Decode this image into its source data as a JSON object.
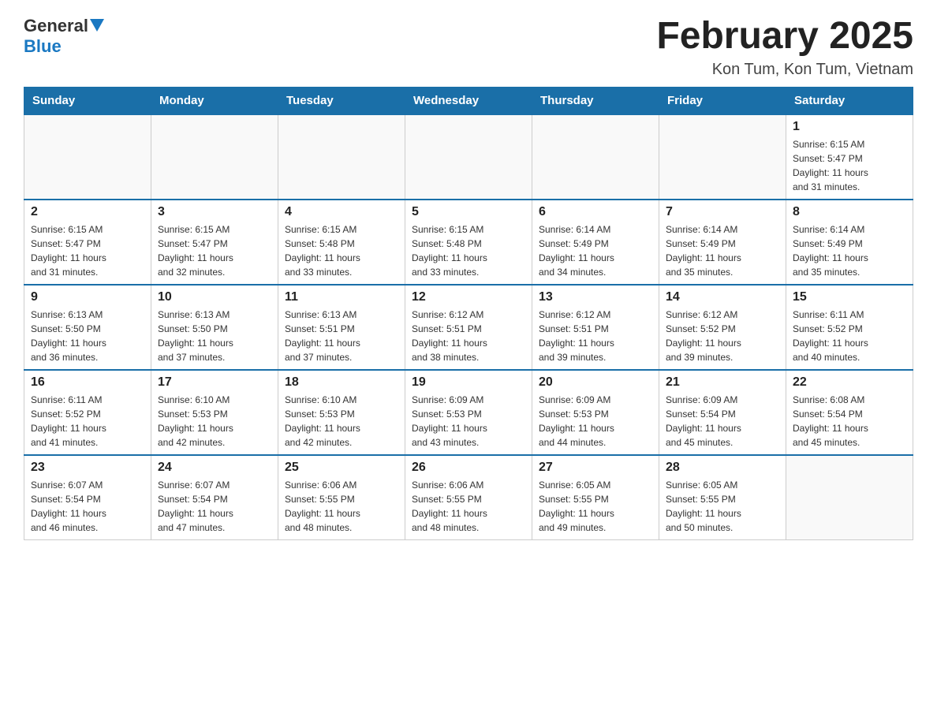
{
  "header": {
    "logo_general": "General",
    "logo_blue": "Blue",
    "month_title": "February 2025",
    "location": "Kon Tum, Kon Tum, Vietnam"
  },
  "weekdays": [
    "Sunday",
    "Monday",
    "Tuesday",
    "Wednesday",
    "Thursday",
    "Friday",
    "Saturday"
  ],
  "weeks": [
    {
      "days": [
        {
          "number": "",
          "info": ""
        },
        {
          "number": "",
          "info": ""
        },
        {
          "number": "",
          "info": ""
        },
        {
          "number": "",
          "info": ""
        },
        {
          "number": "",
          "info": ""
        },
        {
          "number": "",
          "info": ""
        },
        {
          "number": "1",
          "info": "Sunrise: 6:15 AM\nSunset: 5:47 PM\nDaylight: 11 hours\nand 31 minutes."
        }
      ]
    },
    {
      "days": [
        {
          "number": "2",
          "info": "Sunrise: 6:15 AM\nSunset: 5:47 PM\nDaylight: 11 hours\nand 31 minutes."
        },
        {
          "number": "3",
          "info": "Sunrise: 6:15 AM\nSunset: 5:47 PM\nDaylight: 11 hours\nand 32 minutes."
        },
        {
          "number": "4",
          "info": "Sunrise: 6:15 AM\nSunset: 5:48 PM\nDaylight: 11 hours\nand 33 minutes."
        },
        {
          "number": "5",
          "info": "Sunrise: 6:15 AM\nSunset: 5:48 PM\nDaylight: 11 hours\nand 33 minutes."
        },
        {
          "number": "6",
          "info": "Sunrise: 6:14 AM\nSunset: 5:49 PM\nDaylight: 11 hours\nand 34 minutes."
        },
        {
          "number": "7",
          "info": "Sunrise: 6:14 AM\nSunset: 5:49 PM\nDaylight: 11 hours\nand 35 minutes."
        },
        {
          "number": "8",
          "info": "Sunrise: 6:14 AM\nSunset: 5:49 PM\nDaylight: 11 hours\nand 35 minutes."
        }
      ]
    },
    {
      "days": [
        {
          "number": "9",
          "info": "Sunrise: 6:13 AM\nSunset: 5:50 PM\nDaylight: 11 hours\nand 36 minutes."
        },
        {
          "number": "10",
          "info": "Sunrise: 6:13 AM\nSunset: 5:50 PM\nDaylight: 11 hours\nand 37 minutes."
        },
        {
          "number": "11",
          "info": "Sunrise: 6:13 AM\nSunset: 5:51 PM\nDaylight: 11 hours\nand 37 minutes."
        },
        {
          "number": "12",
          "info": "Sunrise: 6:12 AM\nSunset: 5:51 PM\nDaylight: 11 hours\nand 38 minutes."
        },
        {
          "number": "13",
          "info": "Sunrise: 6:12 AM\nSunset: 5:51 PM\nDaylight: 11 hours\nand 39 minutes."
        },
        {
          "number": "14",
          "info": "Sunrise: 6:12 AM\nSunset: 5:52 PM\nDaylight: 11 hours\nand 39 minutes."
        },
        {
          "number": "15",
          "info": "Sunrise: 6:11 AM\nSunset: 5:52 PM\nDaylight: 11 hours\nand 40 minutes."
        }
      ]
    },
    {
      "days": [
        {
          "number": "16",
          "info": "Sunrise: 6:11 AM\nSunset: 5:52 PM\nDaylight: 11 hours\nand 41 minutes."
        },
        {
          "number": "17",
          "info": "Sunrise: 6:10 AM\nSunset: 5:53 PM\nDaylight: 11 hours\nand 42 minutes."
        },
        {
          "number": "18",
          "info": "Sunrise: 6:10 AM\nSunset: 5:53 PM\nDaylight: 11 hours\nand 42 minutes."
        },
        {
          "number": "19",
          "info": "Sunrise: 6:09 AM\nSunset: 5:53 PM\nDaylight: 11 hours\nand 43 minutes."
        },
        {
          "number": "20",
          "info": "Sunrise: 6:09 AM\nSunset: 5:53 PM\nDaylight: 11 hours\nand 44 minutes."
        },
        {
          "number": "21",
          "info": "Sunrise: 6:09 AM\nSunset: 5:54 PM\nDaylight: 11 hours\nand 45 minutes."
        },
        {
          "number": "22",
          "info": "Sunrise: 6:08 AM\nSunset: 5:54 PM\nDaylight: 11 hours\nand 45 minutes."
        }
      ]
    },
    {
      "days": [
        {
          "number": "23",
          "info": "Sunrise: 6:07 AM\nSunset: 5:54 PM\nDaylight: 11 hours\nand 46 minutes."
        },
        {
          "number": "24",
          "info": "Sunrise: 6:07 AM\nSunset: 5:54 PM\nDaylight: 11 hours\nand 47 minutes."
        },
        {
          "number": "25",
          "info": "Sunrise: 6:06 AM\nSunset: 5:55 PM\nDaylight: 11 hours\nand 48 minutes."
        },
        {
          "number": "26",
          "info": "Sunrise: 6:06 AM\nSunset: 5:55 PM\nDaylight: 11 hours\nand 48 minutes."
        },
        {
          "number": "27",
          "info": "Sunrise: 6:05 AM\nSunset: 5:55 PM\nDaylight: 11 hours\nand 49 minutes."
        },
        {
          "number": "28",
          "info": "Sunrise: 6:05 AM\nSunset: 5:55 PM\nDaylight: 11 hours\nand 50 minutes."
        },
        {
          "number": "",
          "info": ""
        }
      ]
    }
  ]
}
